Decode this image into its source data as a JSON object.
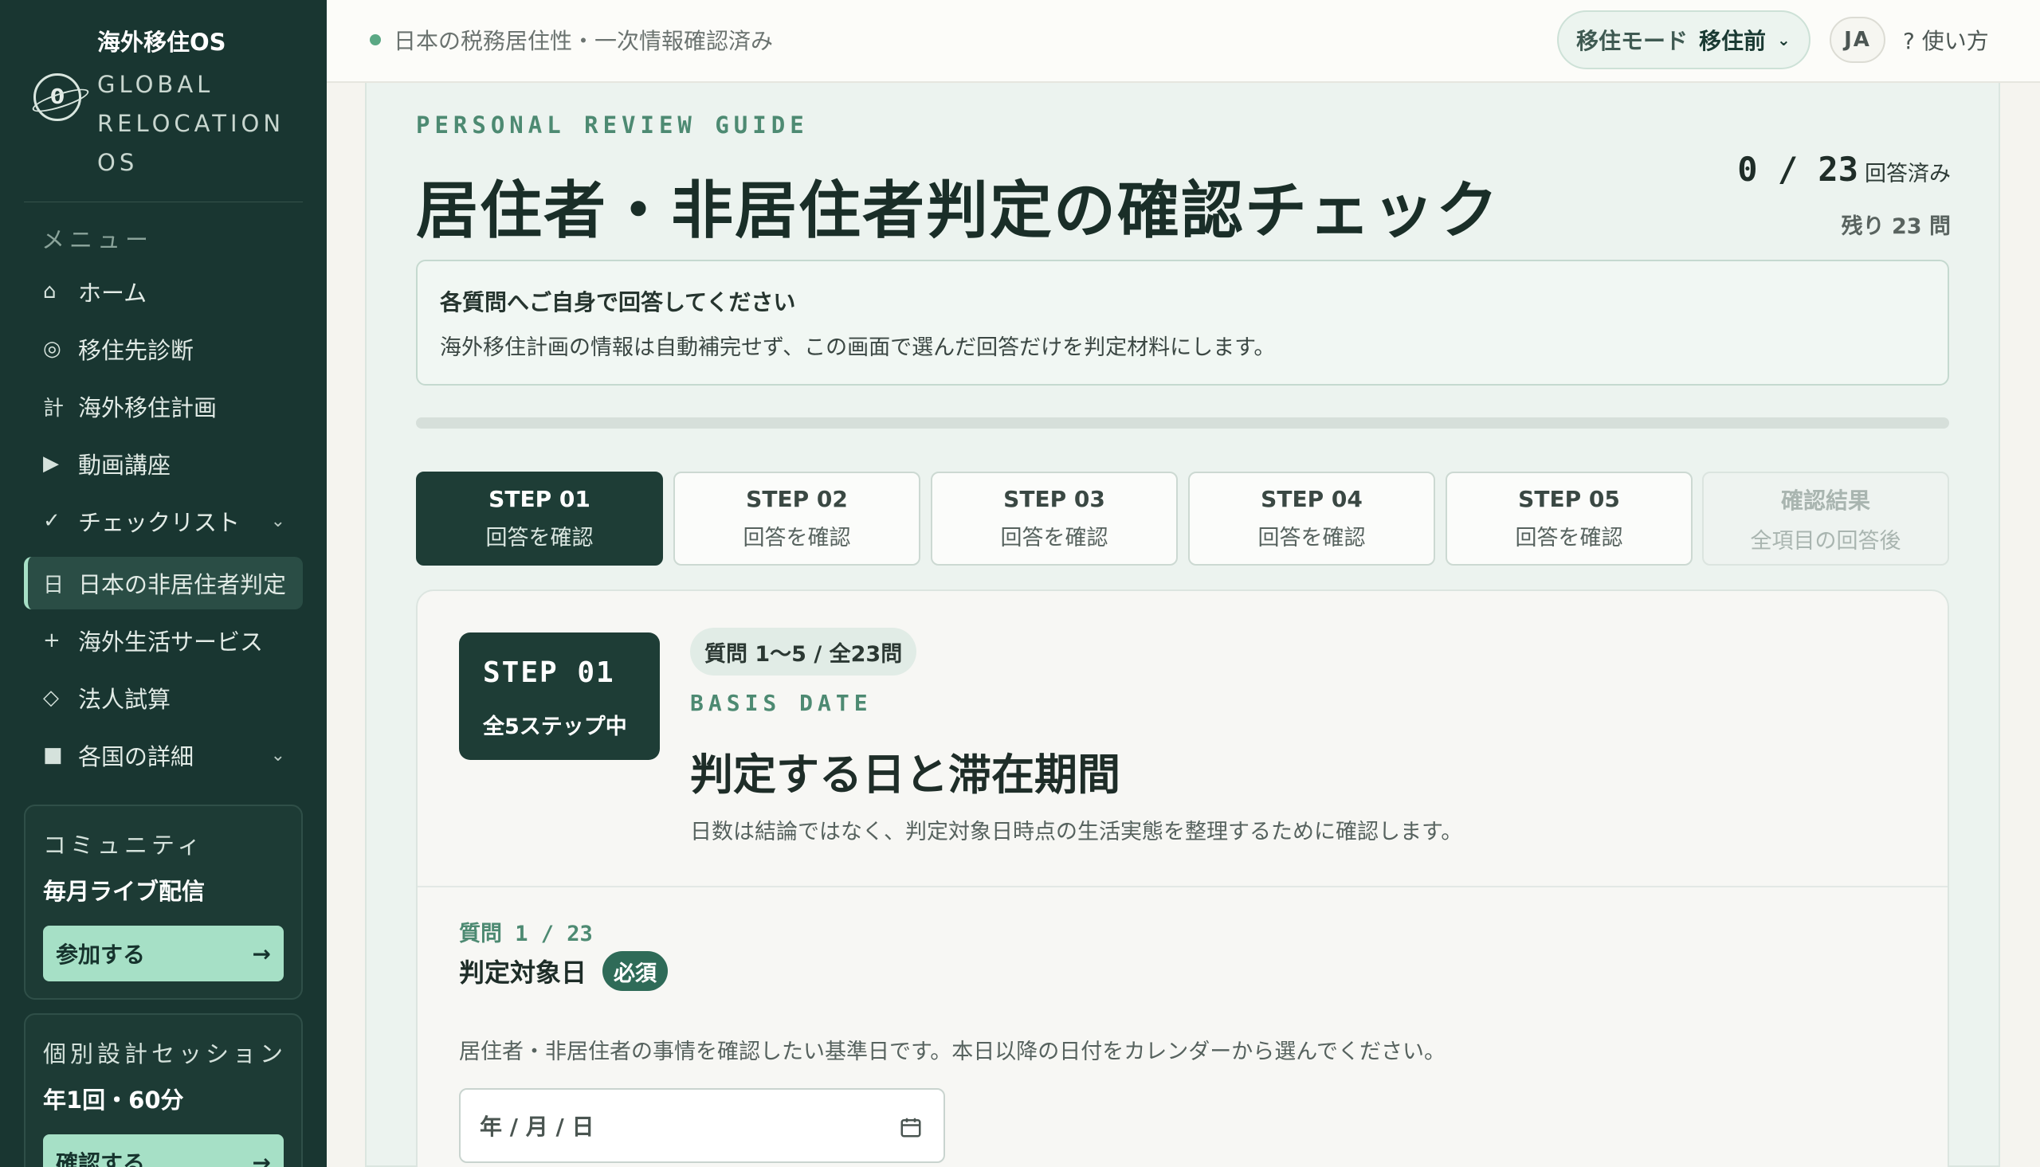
{
  "brand": {
    "title": "海外移住OS",
    "subtitle": "GLOBAL RELOCATION OS",
    "logo_glyph": "0"
  },
  "sidebar": {
    "menu_label": "メニュー",
    "items": [
      {
        "icon": "⌂",
        "label": "ホーム"
      },
      {
        "icon": "◎",
        "label": "移住先診断"
      },
      {
        "icon": "計",
        "label": "海外移住計画"
      },
      {
        "icon": "▶",
        "label": "動画講座"
      },
      {
        "icon": "✓",
        "label": "チェックリスト",
        "chevron": "⌄"
      },
      {
        "icon": "日",
        "label": "日本の非居住者判定",
        "active": true
      },
      {
        "icon": "+",
        "label": "海外生活サービス"
      },
      {
        "icon": "◇",
        "label": "法人試算"
      },
      {
        "icon": "■",
        "label": "各国の詳細",
        "chevron": "⌄"
      }
    ],
    "community": {
      "label": "コミュニティ",
      "title": "毎月ライブ配信",
      "button": "参加する",
      "arrow": "→"
    },
    "session": {
      "label": "個別設計セッション",
      "title": "年1回・60分",
      "button": "確認する",
      "arrow": "→"
    }
  },
  "topbar": {
    "status_text": "日本の税務居住性・一次情報確認済み",
    "mode_label": "移住モード",
    "mode_value": "移住前",
    "mode_chevron": "⌄",
    "lang": "JA",
    "help": "? 使い方"
  },
  "page": {
    "eyebrow": "PERSONAL REVIEW GUIDE",
    "title": "居住者・非居住者判定の確認チェック",
    "answered_count": "0",
    "total_count": "23",
    "answered_label": "回答済み",
    "remaining_label": "残り 23 問",
    "progress_fraction": 0,
    "notice": {
      "title": "各質問へご自身で回答してください",
      "body": "海外移住計画の情報は自動補完せず、この画面で選んだ回答だけを判定材料にします。"
    }
  },
  "steps": [
    {
      "title": "STEP 01",
      "subtitle": "回答を確認",
      "state": "active"
    },
    {
      "title": "STEP 02",
      "subtitle": "回答を確認",
      "state": "normal"
    },
    {
      "title": "STEP 03",
      "subtitle": "回答を確認",
      "state": "normal"
    },
    {
      "title": "STEP 04",
      "subtitle": "回答を確認",
      "state": "normal"
    },
    {
      "title": "STEP 05",
      "subtitle": "回答を確認",
      "state": "normal"
    },
    {
      "title": "確認結果",
      "subtitle": "全項目の回答後",
      "state": "disabled"
    }
  ],
  "card": {
    "badge_step": "STEP 01",
    "badge_sub": "全5ステップ中",
    "question_range": "質問 1〜5 / 全23問",
    "eyebrow": "BASIS DATE",
    "title": "判定する日と滞在期間",
    "desc": "日数は結論ではなく、判定対象日時点の生活実態を整理するために確認します。",
    "question": {
      "number": "質問 1 / 23",
      "title": "判定対象日",
      "required": "必須",
      "help": "居住者・非居住者の事情を確認したい基準日です。本日以降の日付をカレンダーから選んでください。",
      "placeholder": "年 / 月 / 日"
    }
  },
  "colors": {
    "sidebar_bg": "#193631",
    "accent": "#a6e0c6",
    "dark_green": "#1e3d36",
    "label_green": "#4d8a72"
  }
}
